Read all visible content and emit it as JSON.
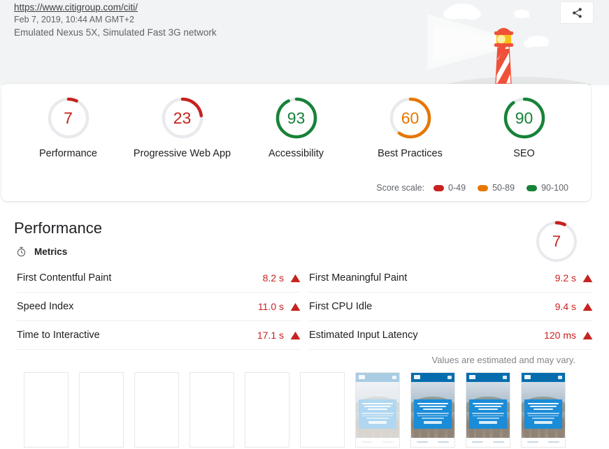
{
  "header": {
    "url": "https://www.citigroup.com/citi/",
    "timestamp": "Feb 7, 2019, 10:44 AM GMT+2",
    "environment": "Emulated Nexus 5X, Simulated Fast 3G network",
    "share_icon": "share-icon",
    "illustration": "lighthouse-illustration"
  },
  "colors": {
    "fail": "#c7221f",
    "average": "#e67700",
    "pass": "#178239",
    "track": "#e8eaed",
    "banner_bg": "#f1f3f4"
  },
  "scores": {
    "categories": [
      {
        "label": "Performance",
        "value": "7",
        "score": 7,
        "rating": "fail"
      },
      {
        "label": "Progressive Web App",
        "value": "23",
        "score": 23,
        "rating": "fail"
      },
      {
        "label": "Accessibility",
        "value": "93",
        "score": 93,
        "rating": "pass"
      },
      {
        "label": "Best Practices",
        "value": "60",
        "score": 60,
        "rating": "average"
      },
      {
        "label": "SEO",
        "value": "90",
        "score": 90,
        "rating": "pass"
      }
    ],
    "scale": {
      "label": "Score scale:",
      "items": [
        {
          "range": "0-49",
          "color": "#c7221f"
        },
        {
          "range": "50-89",
          "color": "#e67700"
        },
        {
          "range": "90-100",
          "color": "#178239"
        }
      ]
    }
  },
  "performance": {
    "title": "Performance",
    "score_value": "7",
    "score": 7,
    "rating": "fail",
    "metrics_heading": "Metrics",
    "metrics_icon": "stopwatch-icon",
    "estimate_note": "Values are estimated and may vary.",
    "metrics_left": [
      {
        "name": "First Contentful Paint",
        "value": "8.2 s",
        "rating": "fail",
        "icon": "warning-triangle-icon"
      },
      {
        "name": "Speed Index",
        "value": "11.0 s",
        "rating": "fail",
        "icon": "warning-triangle-icon"
      },
      {
        "name": "Time to Interactive",
        "value": "17.1 s",
        "rating": "fail",
        "icon": "warning-triangle-icon"
      }
    ],
    "metrics_right": [
      {
        "name": "First Meaningful Paint",
        "value": "9.2 s",
        "rating": "fail",
        "icon": "warning-triangle-icon"
      },
      {
        "name": "First CPU Idle",
        "value": "9.4 s",
        "rating": "fail",
        "icon": "warning-triangle-icon"
      },
      {
        "name": "Estimated Input Latency",
        "value": "120 ms",
        "rating": "fail",
        "icon": "warning-triangle-icon"
      }
    ]
  },
  "filmstrip": {
    "frames": [
      {
        "state": "blank"
      },
      {
        "state": "blank"
      },
      {
        "state": "blank"
      },
      {
        "state": "blank"
      },
      {
        "state": "blank"
      },
      {
        "state": "blank"
      },
      {
        "state": "faded"
      },
      {
        "state": "loaded"
      },
      {
        "state": "loaded"
      },
      {
        "state": "loaded"
      }
    ]
  }
}
